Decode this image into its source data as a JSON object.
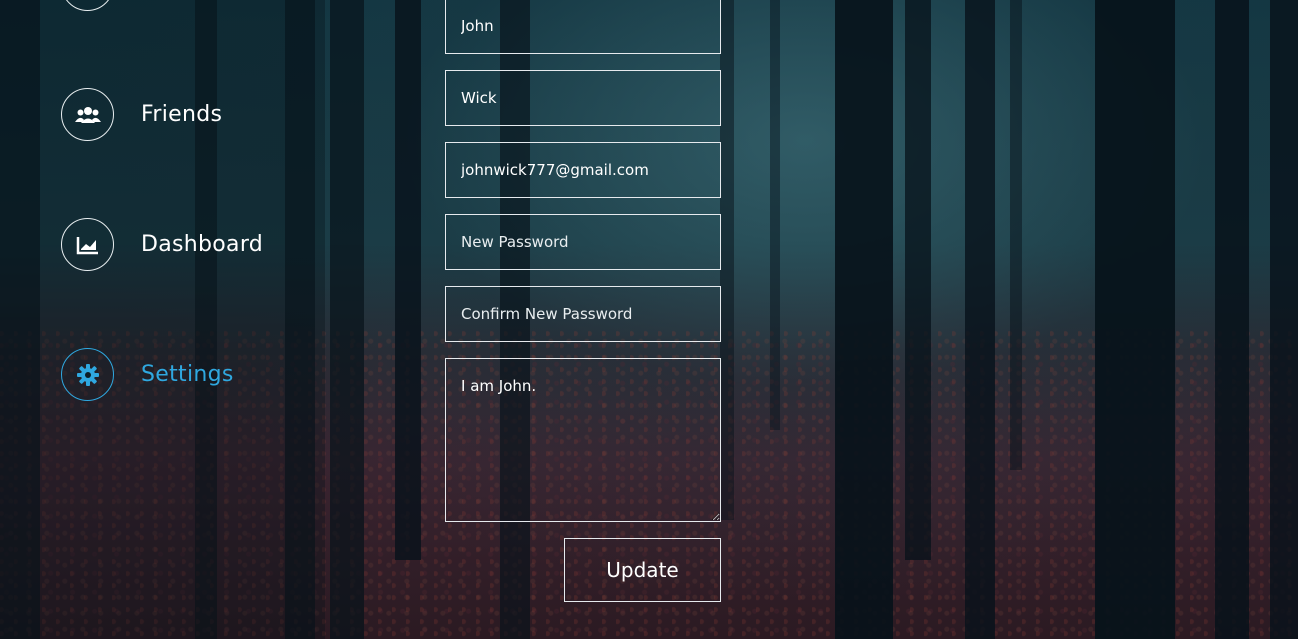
{
  "sidebar": {
    "items": [
      {
        "label": "Friends",
        "icon": "users-icon"
      },
      {
        "label": "Dashboard",
        "icon": "chart-line-icon"
      },
      {
        "label": "Settings",
        "icon": "gear-icon",
        "active": true
      }
    ],
    "accent_color": "#2fa8e0"
  },
  "form": {
    "first_name": "John",
    "last_name": "Wick",
    "email": "johnwick777@gmail.com",
    "new_password_placeholder": "New Password",
    "confirm_password_placeholder": "Confirm New Password",
    "bio": "I am John.",
    "update_label": "Update"
  }
}
